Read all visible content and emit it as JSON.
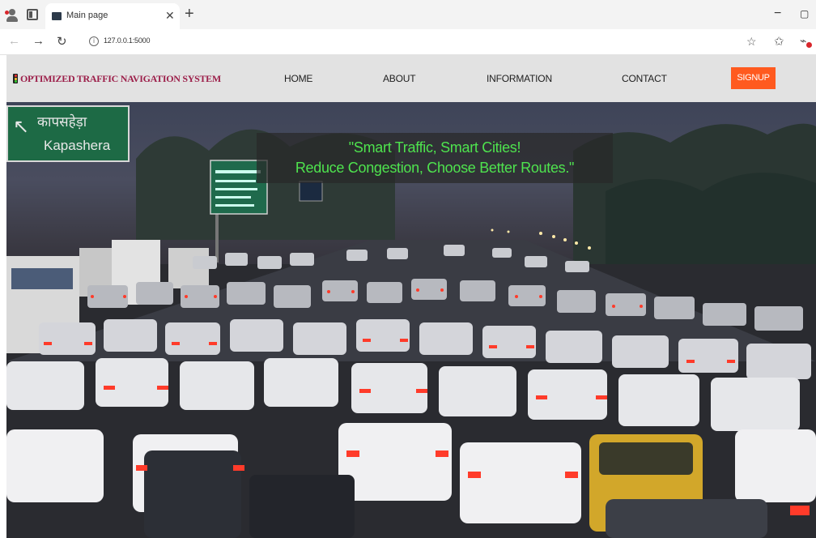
{
  "browser": {
    "tab_title": "Main page",
    "tab_close": "✕",
    "new_tab": "+",
    "url": "127.0.0.1:5000",
    "back": "←",
    "forward": "→",
    "reload": "↻",
    "minimize": "−",
    "maximize": "▢",
    "icons": [
      "profile-icon",
      "tabs-icon",
      "favicon-icon",
      "info-icon",
      "star-icon",
      "favorites-icon",
      "extensions-icon"
    ]
  },
  "site": {
    "brand": "OPTIMIZED TRAFFIC NAVIGATION SYSTEM",
    "nav": [
      "HOME",
      "ABOUT",
      "INFORMATION",
      "CONTACT"
    ],
    "signup": "SIGNUP",
    "colors": {
      "brand": "#9c1f4a",
      "signup_bg": "#ff5a1f",
      "navbar_bg": "#e2e2e2",
      "slogan_text": "#4ee34e"
    }
  },
  "hero": {
    "slogan_line1": "\"Smart Traffic, Smart Cities!",
    "slogan_line2": "Reduce Congestion, Choose Better Routes.\"",
    "sign_hindi": "कापसहेड़ा",
    "sign_english": "Kapashera",
    "image": "traffic-jam-photo"
  }
}
